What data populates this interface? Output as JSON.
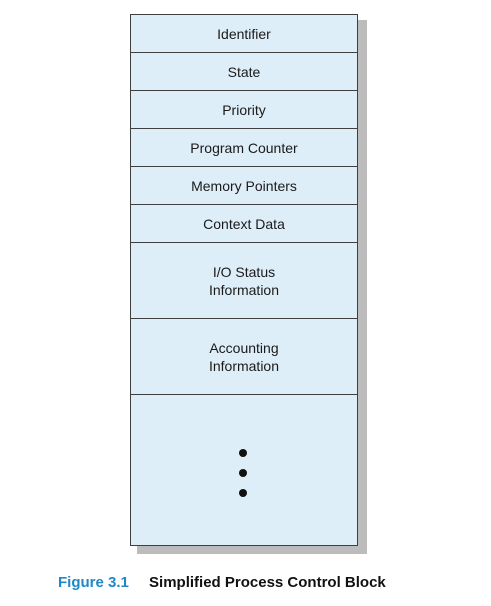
{
  "fields": [
    "Identifier",
    "State",
    "Priority",
    "Program Counter",
    "Memory Pointers",
    "Context Data",
    "I/O Status\nInformation",
    "Accounting\nInformation"
  ],
  "continuation": "vertical-ellipsis",
  "caption": {
    "label": "Figure 3.1",
    "title": "Simplified Process Control Block"
  },
  "colors": {
    "block_fill": "#deeef9",
    "border": "#3f3f3f",
    "caption_label": "#1f88c9",
    "caption_title": "#111111"
  }
}
